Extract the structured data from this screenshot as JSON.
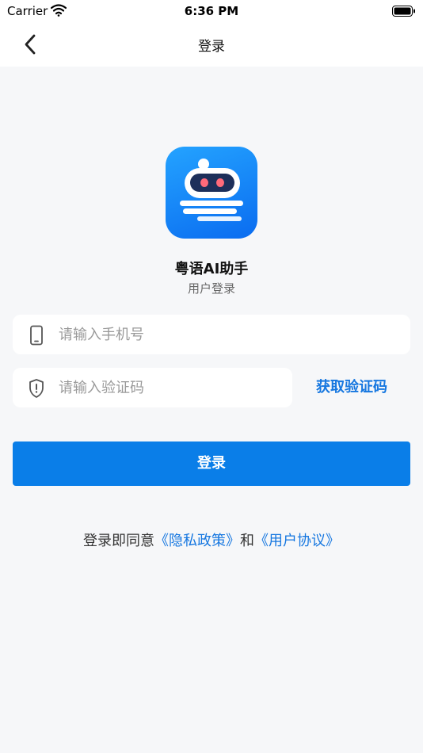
{
  "status_bar": {
    "carrier": "Carrier",
    "time": "6:36 PM"
  },
  "nav": {
    "title": "登录"
  },
  "app": {
    "name": "粤语AI助手",
    "subtitle": "用户登录"
  },
  "form": {
    "phone_placeholder": "请输入手机号",
    "code_placeholder": "请输入验证码",
    "get_code_label": "获取验证码",
    "login_label": "登录"
  },
  "agreement": {
    "prefix": "登录即同意",
    "privacy_link": "《隐私政策》",
    "conjunction": "和",
    "terms_link": "《用户协议》"
  },
  "colors": {
    "accent": "#0a7ee8",
    "link": "#1677e0",
    "background": "#f6f7f9"
  }
}
